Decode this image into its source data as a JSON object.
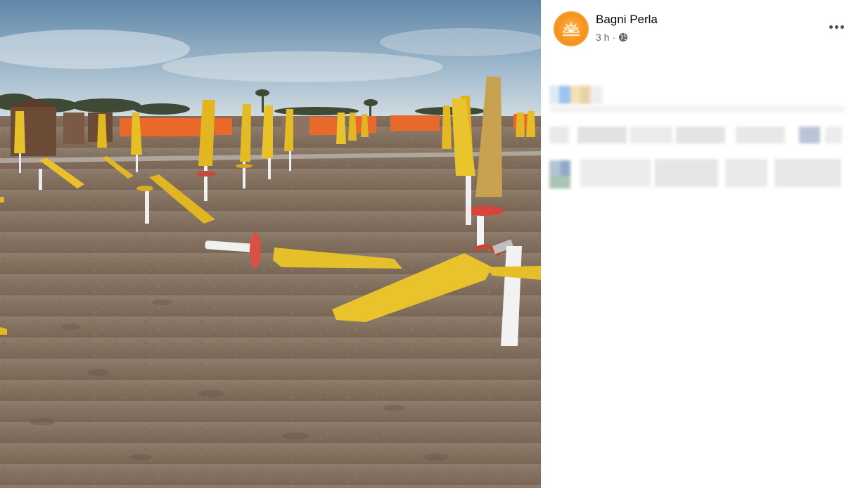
{
  "post": {
    "page_name": "Bagni Perla",
    "time": "3 h",
    "separator": "·",
    "privacy_icon": "globe-icon",
    "more_icon": "more-options-icon",
    "avatar_icon": "shell-logo-icon"
  },
  "photo": {
    "subject": "beach-umbrellas-photo"
  },
  "caption": {
    "state": "blurred"
  },
  "colors": {
    "name_text": "#050505",
    "meta_text": "#65676b",
    "avatar_orange": "#f7931e"
  }
}
